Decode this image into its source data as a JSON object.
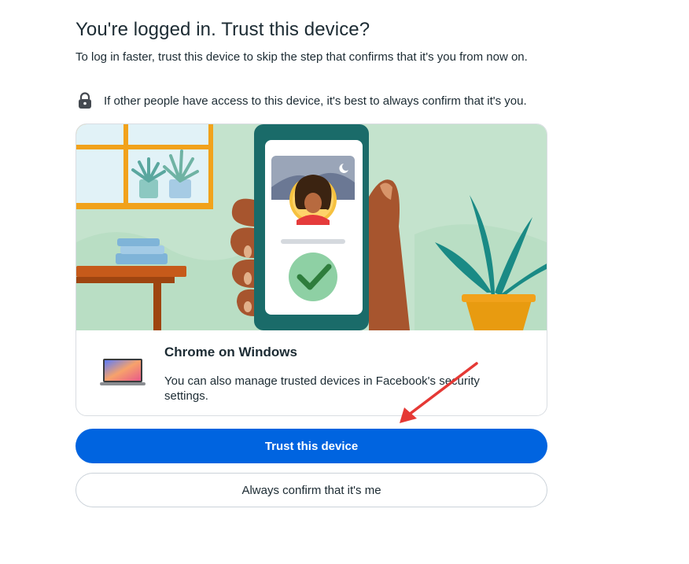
{
  "page": {
    "title": "You're logged in. Trust this device?",
    "subtitle": "To log in faster, trust this device to skip the step that confirms that it's you from now on.",
    "notice": "If other people have access to this device, it's best to always confirm that it's you."
  },
  "device": {
    "name": "Chrome on Windows",
    "description": "You can also manage trusted devices in Facebook's security settings."
  },
  "actions": {
    "trust_label": "Trust this device",
    "confirm_label": "Always confirm that it's me"
  },
  "colors": {
    "primary": "#0064e0",
    "illustration_bg": "#c4e3cd",
    "phone": "#1a6b69",
    "check": "#2e7d3c",
    "annotation_arrow": "#e53935"
  },
  "icons": {
    "notice": "lock-icon",
    "device": "laptop-icon",
    "annotation": "red-arrow"
  }
}
